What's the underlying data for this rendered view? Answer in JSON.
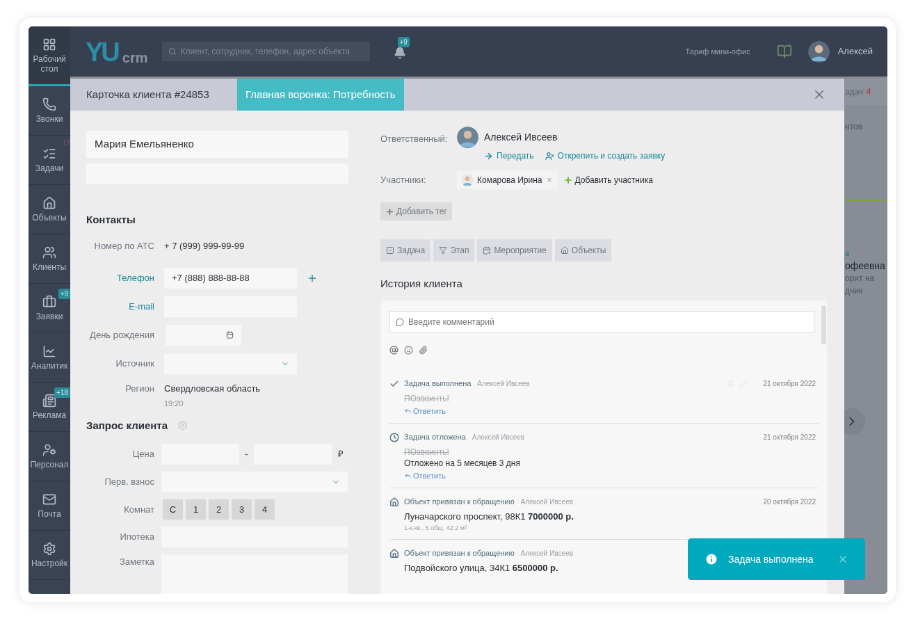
{
  "sidebar": {
    "items": [
      {
        "kind": "dashboard",
        "label": "Рабочий стол",
        "selected": true
      },
      {
        "kind": "phone",
        "label": "Звонки",
        "selected": false
      },
      {
        "kind": "tasks",
        "label": "Задачи",
        "selected": false,
        "badge": {
          "kind": "faint",
          "text": "17"
        }
      },
      {
        "kind": "home",
        "label": "Объекты",
        "selected": false
      },
      {
        "kind": "clients",
        "label": "Клиенты",
        "selected": false
      },
      {
        "kind": "requests",
        "label": "Заявки",
        "selected": false,
        "badge": {
          "kind": "pill",
          "text": "+9"
        }
      },
      {
        "kind": "analytics",
        "label": "Аналитик",
        "selected": false
      },
      {
        "kind": "ads",
        "label": "Реклама",
        "selected": false,
        "badge": {
          "kind": "pill",
          "text": "+18"
        }
      },
      {
        "kind": "staff",
        "label": "Персонал",
        "selected": false
      },
      {
        "kind": "mail",
        "label": "Почта",
        "selected": false
      },
      {
        "kind": "settings",
        "label": "Настройк",
        "selected": false
      }
    ]
  },
  "topbar": {
    "logo": {
      "mark": "YU",
      "suffix": "crm"
    },
    "search": {
      "placeholder": "Клиент, сотрудник, телефон, адрес объекта"
    },
    "notifications": {
      "badge": "+9"
    },
    "tariff": "Тариф мини-офис",
    "user": {
      "name": "Алексей"
    }
  },
  "backdrop": {
    "header": {
      "text": "адач",
      "count": "4"
    },
    "sections": [
      {
        "lines": [
          {
            "kind": "muted",
            "text": "нтов"
          }
        ]
      },
      {
        "lines": [
          {
            "kind": "link",
            "text": "а"
          },
          {
            "kind": "strong",
            "text": "офеевна"
          },
          {
            "kind": "muted",
            "text": "орит на"
          },
          {
            "kind": "muted",
            "text": "дчик"
          }
        ]
      }
    ]
  },
  "modal": {
    "title": "Карточка клиента #24853",
    "stage": "Главная воронка: Потребность",
    "client": {
      "name": "Мария Емельяненко"
    },
    "contacts": {
      "title": "Контакты",
      "rows": [
        {
          "kind": "text",
          "label": "Номер по АТС",
          "linked": false,
          "value": "+ 7 (999) 999-99-99"
        },
        {
          "kind": "input",
          "label": "Телефон",
          "linked": true,
          "value": "+7 (888) 888-88-88",
          "addable": true
        },
        {
          "kind": "input",
          "label": "E-mail",
          "linked": true
        },
        {
          "kind": "date",
          "label": "День рождения",
          "linked": false
        },
        {
          "kind": "select",
          "label": "Источник",
          "linked": false
        },
        {
          "kind": "text",
          "label": "Регион",
          "linked": false,
          "value": "Свердловская область",
          "note": "19:20"
        }
      ]
    },
    "request": {
      "title": "Запрос клиента",
      "rows": [
        {
          "kind": "range",
          "label": "Цена",
          "separator": "-",
          "unit": "₽"
        },
        {
          "kind": "select",
          "label": "Перв. взнос"
        },
        {
          "kind": "options",
          "label": "Комнат",
          "options": [
            {
              "label": "С",
              "selected": false
            },
            {
              "label": "1",
              "selected": false
            },
            {
              "label": "2",
              "selected": false
            },
            {
              "label": "3",
              "selected": false
            },
            {
              "label": "4",
              "selected": false
            }
          ]
        },
        {
          "kind": "input",
          "label": "Ипотека"
        },
        {
          "kind": "textarea",
          "label": "Заметка"
        }
      ]
    },
    "responsible": {
      "label": "Ответственный:",
      "name": "Алексей Ивсеев",
      "actions": [
        {
          "kind": "transfer",
          "label": "Передать"
        },
        {
          "kind": "unpin",
          "label": "Открепить и создать заявку"
        }
      ]
    },
    "participants": {
      "label": "Участники:",
      "people": [
        {
          "name": "Комарова Ирина",
          "remove": "×"
        }
      ],
      "add": "Добавить участника"
    },
    "add_tag": "Добавить тег",
    "actions": [
      {
        "kind": "task",
        "label": "Задача"
      },
      {
        "kind": "stage",
        "label": "Этап"
      },
      {
        "kind": "event",
        "label": "Мероприятие"
      },
      {
        "kind": "objects",
        "label": "Объекты"
      }
    ],
    "history": {
      "title": "История клиента",
      "comment_placeholder": "Введите комментарий",
      "entries": [
        {
          "kind": "done",
          "title": "Задача выполнена",
          "author": "Алексей Ивсеев",
          "date": "21 октября 2022",
          "tools": true,
          "struck": "ПОзвоинть!",
          "reply": "Ответить"
        },
        {
          "kind": "postponed",
          "title": "Задача отложена",
          "author": "Алексей Ивсеев",
          "date": "21 октября 2022",
          "tools": false,
          "struck": "ПОзвоинть!",
          "text": "Отложено на 5 месяцев 3 дня",
          "reply": "Ответить"
        },
        {
          "kind": "object",
          "title": "Объект привязан к обращению",
          "author": "Алексей Ивсеев",
          "date": "20 октября 2022",
          "tools": false,
          "address": "Луначарского проспект, 98К1 **7000000 р.**",
          "details": "1-к.кв., 5 общ. 42.2 м²"
        },
        {
          "kind": "object",
          "title": "Объект привязан к обращению",
          "author": "Алексей Ивсеев",
          "tools": false,
          "address": "Подвойского улица, 34К1 **6500000 р.**"
        }
      ]
    }
  },
  "toast": {
    "text": "Задача выполнена"
  }
}
